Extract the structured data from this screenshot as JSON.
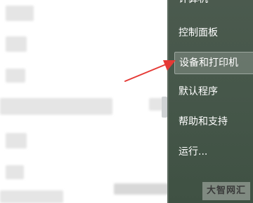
{
  "start_menu": {
    "items": [
      {
        "label": "计算机"
      },
      {
        "label": "控制面板"
      },
      {
        "label": "设备和打印机"
      },
      {
        "label": "默认程序"
      },
      {
        "label": "帮助和支持"
      },
      {
        "label": "运行..."
      }
    ],
    "highlighted_index": 2
  },
  "watermark": {
    "text": "大智网汇"
  },
  "annotation": {
    "arrow_color": "#e53935",
    "icon": "red-arrow-icon"
  }
}
